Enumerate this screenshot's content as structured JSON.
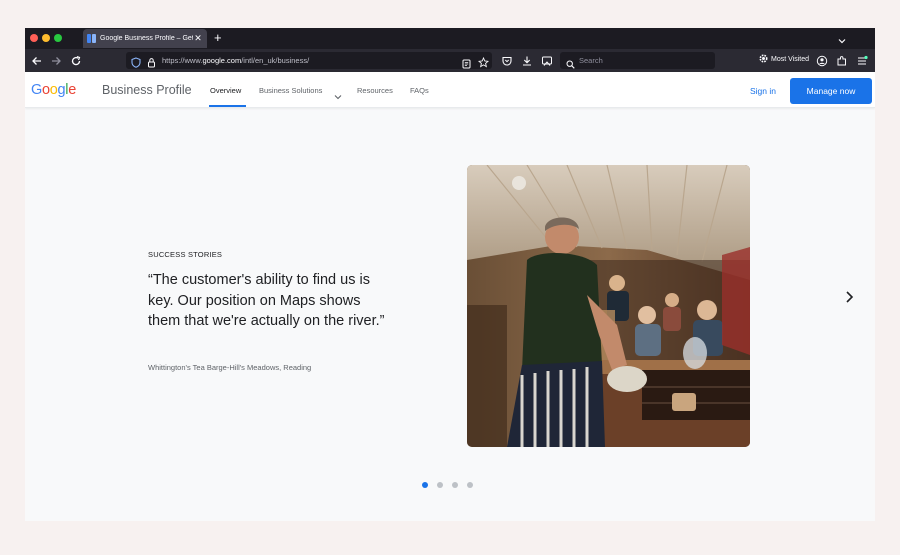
{
  "browser": {
    "tab_title": "Google Business Profile – Get L",
    "tab_close": "✕",
    "new_tab": "+",
    "url_scheme": "https://www.",
    "url_domain": "google.com",
    "url_path": "/intl/en_uk/business/",
    "search_placeholder": "Search",
    "most_visited": "Most Visited"
  },
  "header": {
    "logo": {
      "g1": "G",
      "o1": "o",
      "o2": "o",
      "g2": "g",
      "l": "l",
      "e": "e"
    },
    "product": "Business Profile",
    "nav": [
      "Overview",
      "Business Solutions",
      "Resources",
      "FAQs"
    ],
    "sign_in": "Sign in",
    "cta": "Manage now"
  },
  "story": {
    "eyebrow": "SUCCESS STORIES",
    "quote": "“The customer's ability to find us is key. Our position on Maps shows them that we're actually on the river.”",
    "source": "Whittington's Tea Barge-Hill's Meadows, Reading"
  },
  "carousel": {
    "total_slides": 4,
    "active_index": 0
  },
  "colors": {
    "accent": "#1a73e8",
    "browser_chrome": "#1c1b22",
    "toolbar": "#2b2a33",
    "page_bg": "#f8f9fa"
  },
  "icons": [
    "shield-icon",
    "lock-icon",
    "reader-icon",
    "star-icon",
    "pocket-icon",
    "download-icon",
    "screenshot-icon",
    "search-icon",
    "gear-icon",
    "account-icon",
    "extensions-icon",
    "menu-icon",
    "chevron-right-icon"
  ]
}
